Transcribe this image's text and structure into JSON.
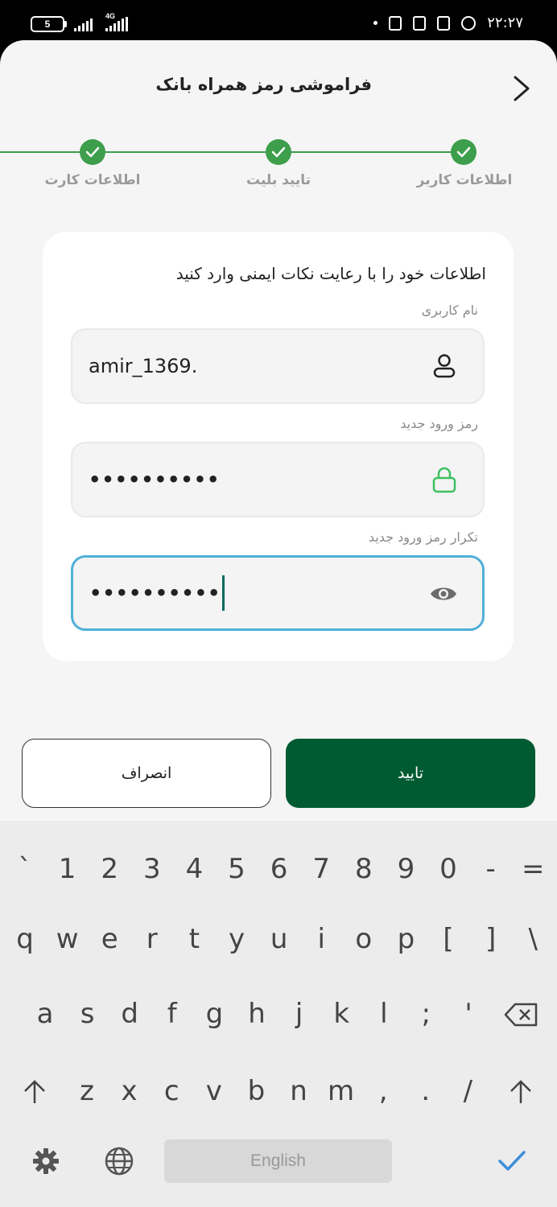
{
  "status_bar": {
    "battery_level": "5",
    "network_type": "4G",
    "time": "۲۲:۲۷"
  },
  "header": {
    "title": "فراموشی رمز همراه بانک",
    "back_icon": "chevron-right-icon"
  },
  "steps": [
    {
      "label": "اطلاعات کاربر",
      "done": true
    },
    {
      "label": "تایید بلیت",
      "done": true
    },
    {
      "label": "اطلاعات کارت",
      "done": true
    }
  ],
  "form": {
    "instruction": "اطلاعات خود را با رعایت نکات ایمنی وارد کنید",
    "username": {
      "label": "نام کاربری",
      "value": "amir_1369.",
      "icon": "user-icon"
    },
    "new_password": {
      "label": "رمز ورود جدید",
      "value": "••••••••••",
      "icon": "lock-icon"
    },
    "confirm_password": {
      "label": "تکرار رمز ورود جدید",
      "value": "••••••••••",
      "icon": "eye-icon"
    }
  },
  "buttons": {
    "confirm": "تایید",
    "cancel": "انصراف"
  },
  "keyboard": {
    "row1": [
      "`",
      "1",
      "2",
      "3",
      "4",
      "5",
      "6",
      "7",
      "8",
      "9",
      "0",
      "-",
      "="
    ],
    "row2": [
      "q",
      "w",
      "e",
      "r",
      "t",
      "y",
      "u",
      "i",
      "o",
      "p",
      "[",
      "]",
      "\\"
    ],
    "row3": [
      "a",
      "s",
      "d",
      "f",
      "g",
      "h",
      "j",
      "k",
      "l",
      ";",
      "'"
    ],
    "row4": [
      "z",
      "x",
      "c",
      "v",
      "b",
      "n",
      "m",
      ",",
      ".",
      "/"
    ],
    "space_label": "English"
  },
  "colors": {
    "brand_green": "#005a32",
    "step_green": "#3d9e4b",
    "focus_blue": "#4fb0d8",
    "lock_green": "#3cc060"
  }
}
